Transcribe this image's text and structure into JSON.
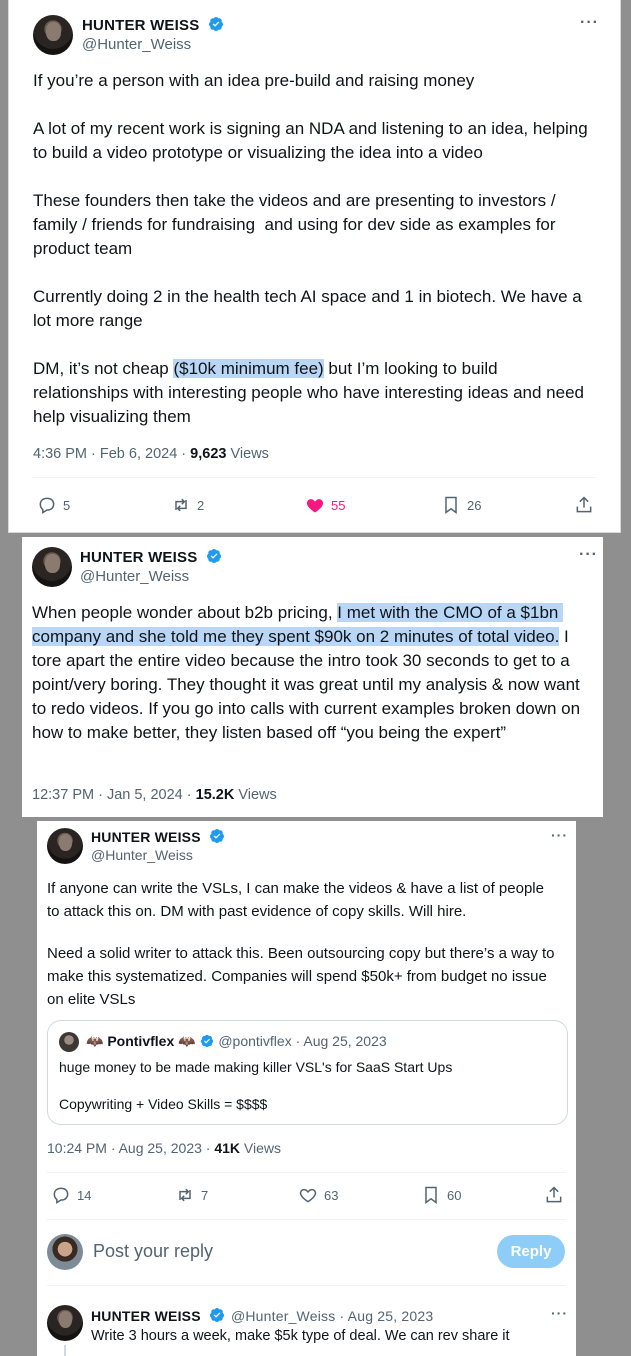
{
  "colors": {
    "verified": "#1d9bf0",
    "like_active": "#f91880",
    "highlight": "#b9d6f5",
    "reply_button": "#8ecdf7"
  },
  "tweet1": {
    "name": "HUNTER WEISS",
    "handle": "@Hunter_Weiss",
    "more": "···",
    "p1": "If you’re a person with an idea pre-build and raising money",
    "p2": "A lot of my recent work is signing an NDA and listening to an idea, helping to build a video prototype or visualizing the idea into a video",
    "p3": "These founders then take the videos and are presenting to investors / family / friends for fundraising  and using for dev side as examples for product team",
    "p4": "Currently doing 2 in the health tech AI space and 1 in biotech. We have a lot more range",
    "p5_before": "DM, it’s not cheap ",
    "p5_highlight": "($10k minimum fee)",
    "p5_after": " but I’m looking to build relationships with interesting people who have interesting ideas and need help visualizing them",
    "time": "4:36 PM · Feb 6, 2024 · ",
    "views_count": "9,623",
    "views_label": " Views",
    "replies": "5",
    "reposts": "2",
    "likes": "55",
    "bookmarks": "26"
  },
  "tweet2": {
    "name": "HUNTER WEISS",
    "handle": "@Hunter_Weiss",
    "more": "···",
    "text_before": "When people wonder about b2b pricing, ",
    "text_highlight": "I met with the CMO of a $1bn company and she told me they spent $90k on 2 minutes of total video.",
    "text_after": " I tore apart the entire video because the intro took 30 seconds to get to a point/very boring. They thought it was great until my analysis & now want to redo videos. If you go into calls with current examples broken down on how to make better, they listen based off “you being the expert”",
    "time": "12:37 PM · Jan 5, 2024 · ",
    "views_count": "15.2K",
    "views_label": " Views"
  },
  "tweet3": {
    "name": "HUNTER WEISS",
    "handle": "@Hunter_Weiss",
    "more": "···",
    "p1": "If anyone can write the VSLs, I can make the videos & have a list of people to attack this on. DM with past evidence of copy skills. Will hire.",
    "p2": "Need a solid writer to attack this. Been outsourcing copy but there’s a way to make this systematized. Companies will spend $50k+ from budget no issue on elite VSLs",
    "quote": {
      "name": "Pontivflex",
      "name_deco": "🦇",
      "handle_date": "@pontivflex · Aug 25, 2023",
      "line1": "huge money to be made making killer VSL's for SaaS Start Ups",
      "line2": "Copywriting + Video Skills = $$$$"
    },
    "time": "10:24 PM · Aug 25, 2023 · ",
    "views_count": "41K",
    "views_label": " Views",
    "replies": "14",
    "reposts": "7",
    "likes": "63",
    "bookmarks": "60"
  },
  "reply_box": {
    "placeholder": "Post your reply",
    "button": "Reply"
  },
  "reply_tweet": {
    "name": "HUNTER WEISS",
    "handle_date": "@Hunter_Weiss · Aug 25, 2023",
    "more": "···",
    "text": "Write 3 hours a week, make $5k type of deal. We can rev share it"
  }
}
